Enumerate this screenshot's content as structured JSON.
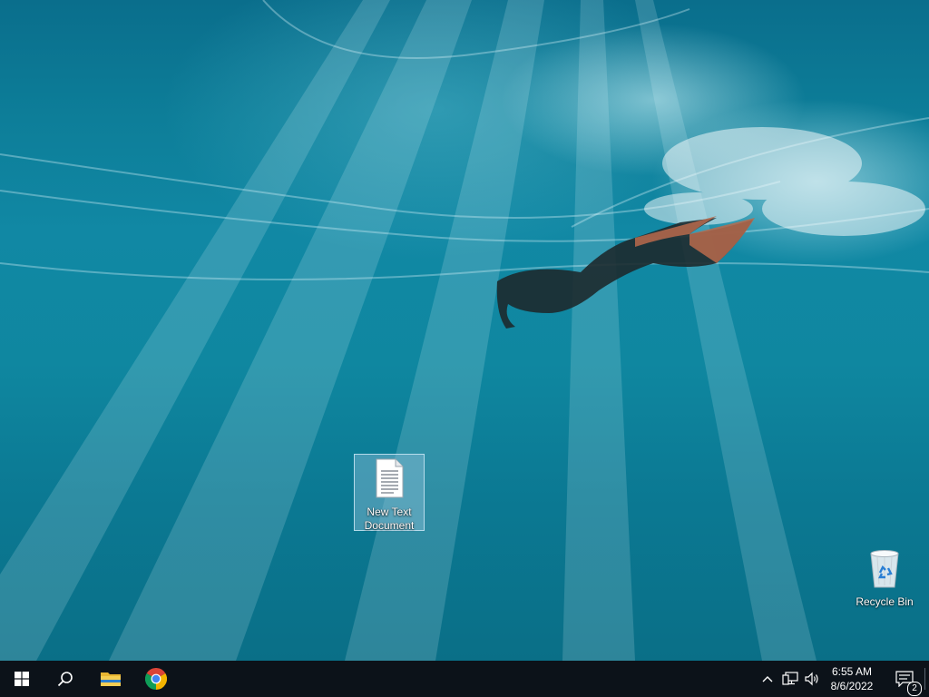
{
  "desktop": {
    "icons": [
      {
        "label": "New Text\nDocument",
        "icon": "text-document-icon",
        "selected": true
      },
      {
        "label": "Recycle Bin",
        "icon": "recycle-bin-icon",
        "selected": false
      }
    ]
  },
  "taskbar": {
    "start_icon": "windows-logo-icon",
    "search_icon": "search-icon",
    "pinned": [
      {
        "name": "File Explorer",
        "icon": "folder-icon"
      },
      {
        "name": "Google Chrome",
        "icon": "chrome-icon"
      }
    ],
    "tray": {
      "chevron_icon": "chevron-up-icon",
      "network_icon": "network-icon",
      "volume_icon": "volume-icon",
      "time": "6:55 AM",
      "date": "8/6/2022",
      "notification_count": "2",
      "notification_icon": "action-center-icon"
    }
  },
  "colors": {
    "taskbar_bg": "#0c1219",
    "water": "#1188a4",
    "selection": "#8cbed7"
  }
}
